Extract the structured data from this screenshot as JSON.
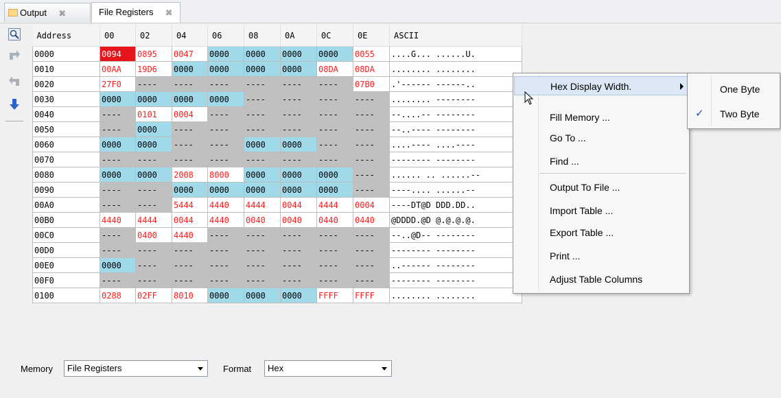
{
  "tabs": [
    {
      "label": "Output",
      "close": "⌘"
    },
    {
      "label": "File Registers",
      "close": "⌘"
    }
  ],
  "grid": {
    "headers": [
      "Address",
      "00",
      "02",
      "04",
      "06",
      "08",
      "0A",
      "0C",
      "0E",
      "ASCII"
    ],
    "rows": [
      {
        "addr": "0000",
        "cells": [
          [
            "0094",
            "sel"
          ],
          [
            "0895",
            "red"
          ],
          [
            "0047",
            "red"
          ],
          [
            "0000",
            "blue"
          ],
          [
            "0000",
            "blue"
          ],
          [
            "0000",
            "blue"
          ],
          [
            "0000",
            "blue"
          ],
          [
            "0055",
            "red"
          ]
        ],
        "ascii": "....G... ......U."
      },
      {
        "addr": "0010",
        "cells": [
          [
            "00AA",
            "red"
          ],
          [
            "19D6",
            "red"
          ],
          [
            "0000",
            "blue"
          ],
          [
            "0000",
            "blue"
          ],
          [
            "0000",
            "blue"
          ],
          [
            "0000",
            "blue"
          ],
          [
            "08DA",
            "red"
          ],
          [
            "08DA",
            "red"
          ]
        ],
        "ascii": "........ ........"
      },
      {
        "addr": "0020",
        "cells": [
          [
            "27F0",
            "red"
          ],
          [
            "----",
            "gray"
          ],
          [
            "----",
            "gray"
          ],
          [
            "----",
            "gray"
          ],
          [
            "----",
            "gray"
          ],
          [
            "----",
            "gray"
          ],
          [
            "----",
            "gray"
          ],
          [
            "07B0",
            "red"
          ]
        ],
        "ascii": ".'------ ------.."
      },
      {
        "addr": "0030",
        "cells": [
          [
            "0000",
            "blue"
          ],
          [
            "0000",
            "blue"
          ],
          [
            "0000",
            "blue"
          ],
          [
            "0000",
            "blue"
          ],
          [
            "----",
            "gray"
          ],
          [
            "----",
            "gray"
          ],
          [
            "----",
            "gray"
          ],
          [
            "----",
            "gray"
          ]
        ],
        "ascii": "........ --------"
      },
      {
        "addr": "0040",
        "cells": [
          [
            "----",
            "gray"
          ],
          [
            "0101",
            "red"
          ],
          [
            "0004",
            "red"
          ],
          [
            "----",
            "gray"
          ],
          [
            "----",
            "gray"
          ],
          [
            "----",
            "gray"
          ],
          [
            "----",
            "gray"
          ],
          [
            "----",
            "gray"
          ]
        ],
        "ascii": "--....-- --------"
      },
      {
        "addr": "0050",
        "cells": [
          [
            "----",
            "gray"
          ],
          [
            "0000",
            "blue"
          ],
          [
            "----",
            "gray"
          ],
          [
            "----",
            "gray"
          ],
          [
            "----",
            "gray"
          ],
          [
            "----",
            "gray"
          ],
          [
            "----",
            "gray"
          ],
          [
            "----",
            "gray"
          ]
        ],
        "ascii": "--..---- --------"
      },
      {
        "addr": "0060",
        "cells": [
          [
            "0000",
            "blue"
          ],
          [
            "0000",
            "blue"
          ],
          [
            "----",
            "gray"
          ],
          [
            "----",
            "gray"
          ],
          [
            "0000",
            "blue"
          ],
          [
            "0000",
            "blue"
          ],
          [
            "----",
            "gray"
          ],
          [
            "----",
            "gray"
          ]
        ],
        "ascii": "....---- ....----"
      },
      {
        "addr": "0070",
        "cells": [
          [
            "----",
            "gray"
          ],
          [
            "----",
            "gray"
          ],
          [
            "----",
            "gray"
          ],
          [
            "----",
            "gray"
          ],
          [
            "----",
            "gray"
          ],
          [
            "----",
            "gray"
          ],
          [
            "----",
            "gray"
          ],
          [
            "----",
            "gray"
          ]
        ],
        "ascii": "-------- --------"
      },
      {
        "addr": "0080",
        "cells": [
          [
            "0000",
            "blue"
          ],
          [
            "0000",
            "blue"
          ],
          [
            "2008",
            "red"
          ],
          [
            "8000",
            "red"
          ],
          [
            "0000",
            "blue"
          ],
          [
            "0000",
            "blue"
          ],
          [
            "0000",
            "blue"
          ],
          [
            "----",
            "gray"
          ]
        ],
        "ascii": "...... .. ......--"
      },
      {
        "addr": "0090",
        "cells": [
          [
            "----",
            "gray"
          ],
          [
            "----",
            "gray"
          ],
          [
            "0000",
            "blue"
          ],
          [
            "0000",
            "blue"
          ],
          [
            "0000",
            "blue"
          ],
          [
            "0000",
            "blue"
          ],
          [
            "0000",
            "blue"
          ],
          [
            "----",
            "gray"
          ]
        ],
        "ascii": "----.... ......--"
      },
      {
        "addr": "00A0",
        "cells": [
          [
            "----",
            "gray"
          ],
          [
            "----",
            "gray"
          ],
          [
            "5444",
            "red"
          ],
          [
            "4440",
            "red"
          ],
          [
            "4444",
            "red"
          ],
          [
            "0044",
            "red"
          ],
          [
            "4444",
            "red"
          ],
          [
            "0004",
            "red"
          ]
        ],
        "ascii": "----DT@D DDD.DD.."
      },
      {
        "addr": "00B0",
        "cells": [
          [
            "4440",
            "red"
          ],
          [
            "4444",
            "red"
          ],
          [
            "0044",
            "red"
          ],
          [
            "4440",
            "red"
          ],
          [
            "0040",
            "red"
          ],
          [
            "0040",
            "red"
          ],
          [
            "0440",
            "red"
          ],
          [
            "0440",
            "red"
          ]
        ],
        "ascii": "@DDDD.@D @.@.@.@."
      },
      {
        "addr": "00C0",
        "cells": [
          [
            "----",
            "gray"
          ],
          [
            "0400",
            "red"
          ],
          [
            "4440",
            "red"
          ],
          [
            "----",
            "gray"
          ],
          [
            "----",
            "gray"
          ],
          [
            "----",
            "gray"
          ],
          [
            "----",
            "gray"
          ],
          [
            "----",
            "gray"
          ]
        ],
        "ascii": "--..@D-- --------"
      },
      {
        "addr": "00D0",
        "cells": [
          [
            "----",
            "gray"
          ],
          [
            "----",
            "gray"
          ],
          [
            "----",
            "gray"
          ],
          [
            "----",
            "gray"
          ],
          [
            "----",
            "gray"
          ],
          [
            "----",
            "gray"
          ],
          [
            "----",
            "gray"
          ],
          [
            "----",
            "gray"
          ]
        ],
        "ascii": "-------- --------"
      },
      {
        "addr": "00E0",
        "cells": [
          [
            "0000",
            "blue"
          ],
          [
            "----",
            "gray"
          ],
          [
            "----",
            "gray"
          ],
          [
            "----",
            "gray"
          ],
          [
            "----",
            "gray"
          ],
          [
            "----",
            "gray"
          ],
          [
            "----",
            "gray"
          ],
          [
            "----",
            "gray"
          ]
        ],
        "ascii": "..------ --------"
      },
      {
        "addr": "00F0",
        "cells": [
          [
            "----",
            "gray"
          ],
          [
            "----",
            "gray"
          ],
          [
            "----",
            "gray"
          ],
          [
            "----",
            "gray"
          ],
          [
            "----",
            "gray"
          ],
          [
            "----",
            "gray"
          ],
          [
            "----",
            "gray"
          ],
          [
            "----",
            "gray"
          ]
        ],
        "ascii": "-------- --------"
      },
      {
        "addr": "0100",
        "cells": [
          [
            "0288",
            "red"
          ],
          [
            "02FF",
            "red"
          ],
          [
            "8010",
            "red"
          ],
          [
            "0000",
            "blue"
          ],
          [
            "0000",
            "blue"
          ],
          [
            "0000",
            "blue"
          ],
          [
            "FFFF",
            "red"
          ],
          [
            "FFFF",
            "red"
          ]
        ],
        "ascii": "........ ........"
      }
    ]
  },
  "bottom": {
    "memory_label": "Memory",
    "memory_value": "File Registers",
    "format_label": "Format",
    "format_value": "Hex"
  },
  "context_menu": {
    "items": [
      "Hex Display Width.",
      "Fill Memory ...",
      "Go To ...",
      "Find ...",
      "Output To File ...",
      "Import Table ...",
      "Export Table ...",
      "Print ...",
      "Adjust Table Columns"
    ]
  },
  "submenu": {
    "items": [
      "One Byte",
      "Two Byte"
    ],
    "checked": "✓"
  },
  "colors": {
    "selected_cell": "#e8141b",
    "changed_text": "#ff1a1a",
    "valid_cell": "#9fd9ea",
    "unimplemented_cell": "#c0c0c0"
  }
}
